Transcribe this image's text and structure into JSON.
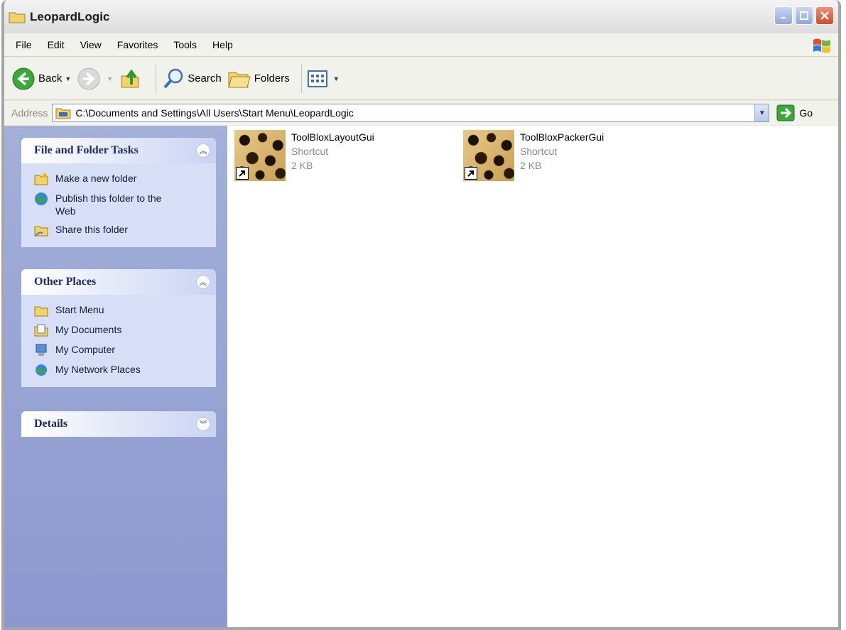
{
  "window": {
    "title": "LeopardLogic"
  },
  "menu": {
    "items": [
      {
        "label": "File"
      },
      {
        "label": "Edit"
      },
      {
        "label": "View"
      },
      {
        "label": "Favorites"
      },
      {
        "label": "Tools"
      },
      {
        "label": "Help"
      }
    ]
  },
  "toolbar": {
    "back_label": "Back",
    "search_label": "Search",
    "folders_label": "Folders"
  },
  "address": {
    "label": "Address",
    "path": "C:\\Documents and Settings\\All Users\\Start Menu\\LeopardLogic",
    "go_label": "Go"
  },
  "tasks_panel": {
    "title": "File and Folder Tasks",
    "items": [
      {
        "label": "Make a new folder",
        "icon": "new-folder-icon"
      },
      {
        "label": "Publish this folder to the Web",
        "icon": "publish-web-icon"
      },
      {
        "label": "Share this folder",
        "icon": "share-folder-icon"
      }
    ]
  },
  "places_panel": {
    "title": "Other Places",
    "items": [
      {
        "label": "Start Menu",
        "icon": "folder-icon"
      },
      {
        "label": "My Documents",
        "icon": "my-documents-icon"
      },
      {
        "label": "My Computer",
        "icon": "my-computer-icon"
      },
      {
        "label": "My Network Places",
        "icon": "network-places-icon"
      }
    ]
  },
  "details_panel": {
    "title": "Details"
  },
  "files": [
    {
      "name": "ToolBloxLayoutGui",
      "type": "Shortcut",
      "size": "2 KB"
    },
    {
      "name": "ToolBloxPackerGui",
      "type": "Shortcut",
      "size": "2 KB"
    }
  ],
  "colors": {
    "titlebar": "#0a4fd8",
    "taskpane": "#8d98cf",
    "panel_body": "#d6dff5"
  }
}
